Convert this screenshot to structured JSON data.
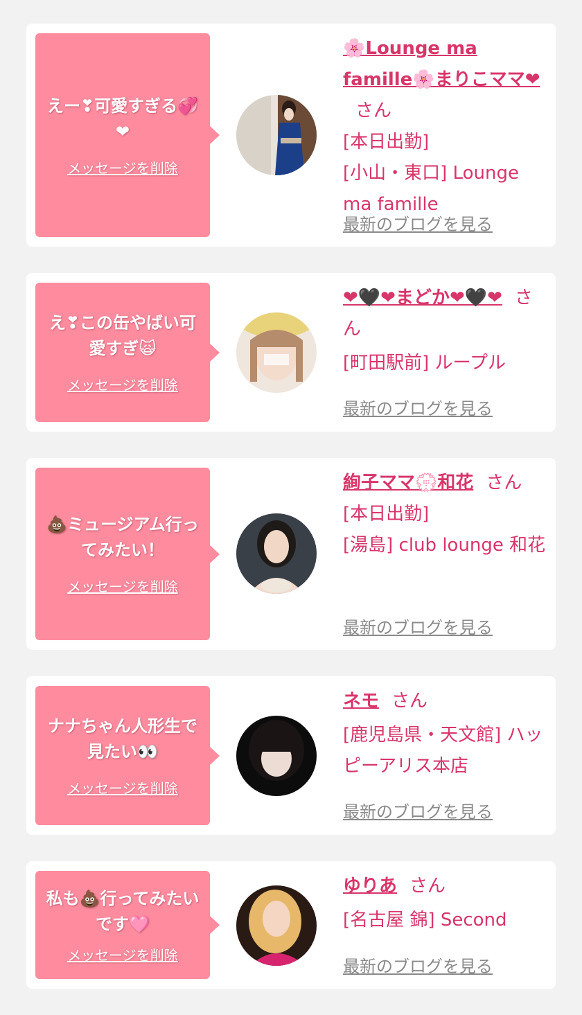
{
  "delete_label": "メッセージを削除",
  "blog_label": "最新のブログを見る",
  "san_label": "さん",
  "colors": {
    "background": "#f2f2f2",
    "card": "#ffffff",
    "bubble": "#fe8b9e",
    "accent": "#d8356a",
    "link_gray": "#8a8a8a"
  },
  "cards": [
    {
      "message": "えー❣可愛すぎる💞❤",
      "name": "🌸Lounge ma famille🌸まりこママ❤",
      "status": "[本日出勤]",
      "location": "[小山・東口] Lounge ma famille",
      "avatar_icon": "kimono-woman-avatar"
    },
    {
      "message": "え❣この缶やばい可愛すぎ🙀",
      "name": "❤🖤❤まどか❤🖤❤",
      "status": "",
      "location": "[町田駅前] ループル",
      "avatar_icon": "woman-avatar"
    },
    {
      "message": "💩ミュージアム行ってみたい！",
      "name": "絢子ママ💮和花",
      "status": "[本日出勤]",
      "location": "[湯島] club lounge 和花",
      "avatar_icon": "woman-avatar"
    },
    {
      "message": "ナナちゃん人形生で見たい👀",
      "name": "ネモ",
      "status": "",
      "location": "[鹿児島県・天文館] ハッピーアリス本店",
      "avatar_icon": "woman-avatar"
    },
    {
      "message": "私も💩行ってみたいです🩷",
      "name": "ゆりあ",
      "status": "",
      "location": "[名古屋 錦] Second",
      "avatar_icon": "blonde-woman-avatar"
    }
  ]
}
